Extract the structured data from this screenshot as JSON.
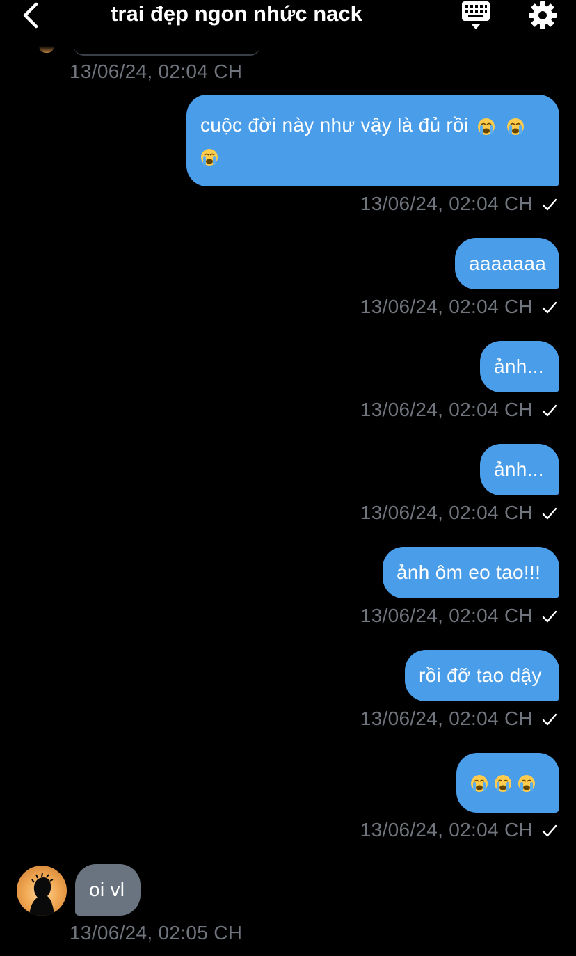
{
  "header": {
    "title": "trai đẹp ngon nhức nack"
  },
  "messages": [
    {
      "side": "out",
      "text": "cuộc đời này như vậy là đủ rồi",
      "emojis": 3,
      "time": "13/06/24, 02:04 CH"
    },
    {
      "side": "out",
      "text": "aaaaaaa",
      "emojis": 0,
      "time": "13/06/24, 02:04 CH"
    },
    {
      "side": "out",
      "text": "ảnh...",
      "emojis": 0,
      "time": "13/06/24, 02:04 CH"
    },
    {
      "side": "out",
      "text": "ảnh...",
      "emojis": 0,
      "time": "13/06/24, 02:04 CH"
    },
    {
      "side": "out",
      "text": "ảnh ôm eo tao!!!",
      "emojis": 0,
      "time": "13/06/24, 02:04 CH"
    },
    {
      "side": "out",
      "text": "rồi đỡ tao dậy",
      "emojis": 0,
      "time": "13/06/24, 02:04 CH"
    },
    {
      "side": "out",
      "text": "",
      "emojis": 3,
      "time": "13/06/24, 02:04 CH"
    },
    {
      "side": "in",
      "text": "oi vl",
      "emojis": 0,
      "time": "13/06/24, 02:05 CH"
    }
  ],
  "previous_message_time": "13/06/24, 02:04 CH",
  "colors": {
    "background": "#000000",
    "outgoing_bubble": "#4a9de8",
    "incoming_bubble": "#6a7480",
    "timestamp": "#6f747d"
  },
  "icons": [
    "back-icon",
    "keyboard-icon",
    "gear-icon",
    "check-icon",
    "crying-emoji-icon"
  ]
}
